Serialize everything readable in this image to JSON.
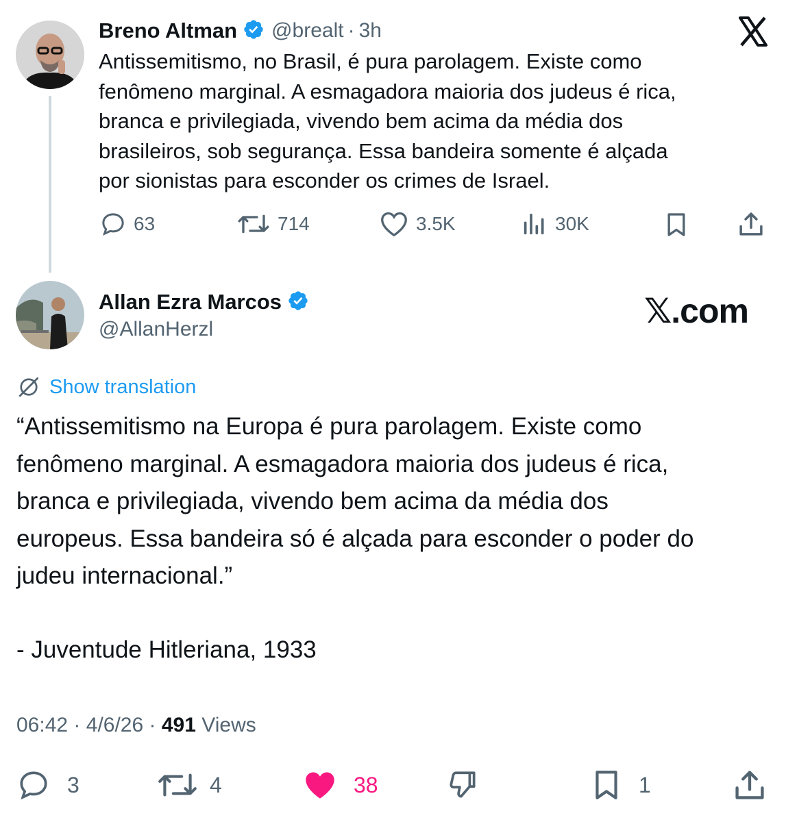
{
  "quoted_tweet": {
    "author_name": "Breno Altman",
    "handle": "@brealt",
    "separator": "·",
    "time": "3h",
    "text_lines": [
      "Antissemitismo, no Brasil, é pura parolagem. Existe como",
      "fenômeno marginal. A esmagadora maioria dos judeus é rica,",
      "branca e privilegiada, vivendo bem acima da média dos",
      "brasileiros, sob segurança. Essa bandeira somente é alçada",
      "por sionistas para esconder os crimes de Israel."
    ],
    "actions": {
      "replies": "63",
      "retweets": "714",
      "likes": "3.5K",
      "views": "30K"
    },
    "x_logo": "𝕏"
  },
  "reply_tweet": {
    "author_name": "Allan Ezra Marcos",
    "handle": "@AllanHerzl",
    "watermark": "𝕏.com",
    "show_translation": "Show translation",
    "text_lines": [
      "“Antissemitismo na Europa é pura parolagem. Existe como",
      "fenômeno marginal. A esmagadora maioria dos judeus é rica,",
      "branca e privilegiada, vivendo bem acima da média dos",
      "europeus. Essa bandeira só é alçada para esconder o poder do",
      "judeu internacional.”"
    ],
    "signature": "- Juventude Hitleriana, 1933",
    "meta": {
      "time": "06:42",
      "sep1": "·",
      "date": "4/6/26",
      "sep2": "·",
      "views_count": "491",
      "views_label": "Views"
    },
    "actions": {
      "replies": "3",
      "retweets": "4",
      "likes": "38",
      "bookmarks": "1"
    }
  },
  "colors": {
    "verified": "#1d9bf0",
    "like_active": "#f91880",
    "link": "#1d9bf0",
    "muted": "#536471"
  },
  "icons": [
    "reply-icon",
    "retweet-icon",
    "like-icon",
    "views-icon",
    "bookmark-icon",
    "share-icon",
    "dislike-icon",
    "translate-icon",
    "verified-badge-icon",
    "x-logo-icon"
  ]
}
